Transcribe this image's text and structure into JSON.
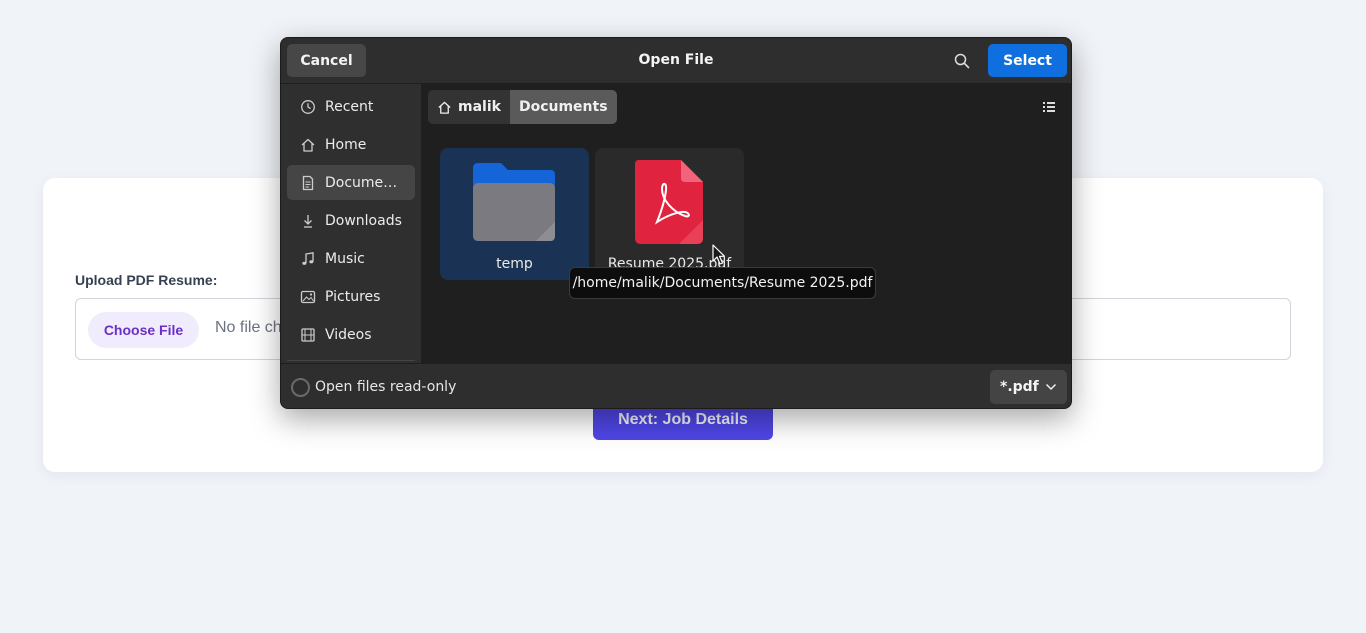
{
  "page": {
    "upload_label": "Upload PDF Resume:",
    "choose_file_label": "Choose File",
    "no_file_text": "No file ch",
    "next_button": "Next: Job Details"
  },
  "dialog": {
    "title": "Open File",
    "cancel_label": "Cancel",
    "select_label": "Select",
    "sidebar": {
      "items": [
        {
          "label": "Recent",
          "icon": "clock-icon"
        },
        {
          "label": "Home",
          "icon": "home-icon"
        },
        {
          "label": "Docume…",
          "icon": "document-icon",
          "active": true
        },
        {
          "label": "Downloads",
          "icon": "download-icon"
        },
        {
          "label": "Music",
          "icon": "music-icon"
        },
        {
          "label": "Pictures",
          "icon": "picture-icon"
        },
        {
          "label": "Videos",
          "icon": "video-icon"
        }
      ]
    },
    "breadcrumb": [
      "malik",
      "Documents"
    ],
    "files": [
      {
        "name": "temp",
        "type": "folder",
        "selected": true
      },
      {
        "name": "Resume 2025.pdf",
        "type": "pdf"
      }
    ],
    "tooltip": "/home/malik/Documents/Resume 2025.pdf",
    "readonly_label": "Open files read-only",
    "filter_value": "*.pdf"
  },
  "colors": {
    "accent": "#0f6fde",
    "selection": "#1a3354",
    "next_button": "#4f46e5",
    "pdf_red": "#e0243f",
    "folder_blue": "#1565d8"
  }
}
